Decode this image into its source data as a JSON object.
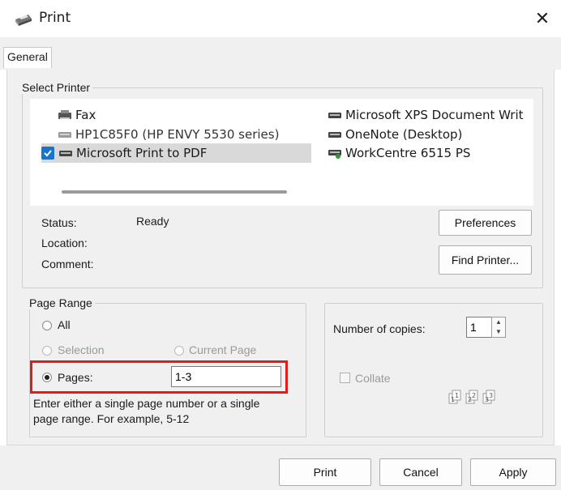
{
  "window": {
    "title": "Print",
    "close_glyph": "✕"
  },
  "tabs": [
    {
      "label": "General"
    }
  ],
  "select_printer": {
    "legend": "Select Printer",
    "printers": [
      {
        "name": "Fax",
        "icon": "fax-printer-icon"
      },
      {
        "name": "HP1C85F0 (HP ENVY 5530 series)",
        "icon": "printer-icon"
      },
      {
        "name": "Microsoft Print to PDF",
        "icon": "printer-icon",
        "selected": true
      },
      {
        "name": "Microsoft XPS Document Writ",
        "icon": "printer-icon"
      },
      {
        "name": "OneNote (Desktop)",
        "icon": "printer-icon"
      },
      {
        "name": "WorkCentre 6515 PS",
        "icon": "network-printer-icon"
      }
    ],
    "status_label": "Status:",
    "status_value": "Ready",
    "location_label": "Location:",
    "location_value": "",
    "comment_label": "Comment:",
    "comment_value": "",
    "preferences_button": "Preferences",
    "find_printer_button": "Find Printer..."
  },
  "page_range": {
    "legend": "Page Range",
    "all_label": "All",
    "selection_label": "Selection",
    "current_page_label": "Current Page",
    "pages_label": "Pages:",
    "pages_value": "1-3",
    "selected_option": "Pages",
    "help_text_line1": "Enter either a single page number or a single",
    "help_text_line2": "page range.  For example, 5-12"
  },
  "copies": {
    "number_label": "Number of copies:",
    "number_value": "1",
    "collate_label": "Collate",
    "collate_checked": false,
    "collate_enabled": false
  },
  "buttons": {
    "print": "Print",
    "cancel": "Cancel",
    "apply": "Apply"
  },
  "colors": {
    "highlight_border": "#e41b1b",
    "selected_check": "#1a73c7",
    "dialog_bg": "#f0f0f0"
  }
}
